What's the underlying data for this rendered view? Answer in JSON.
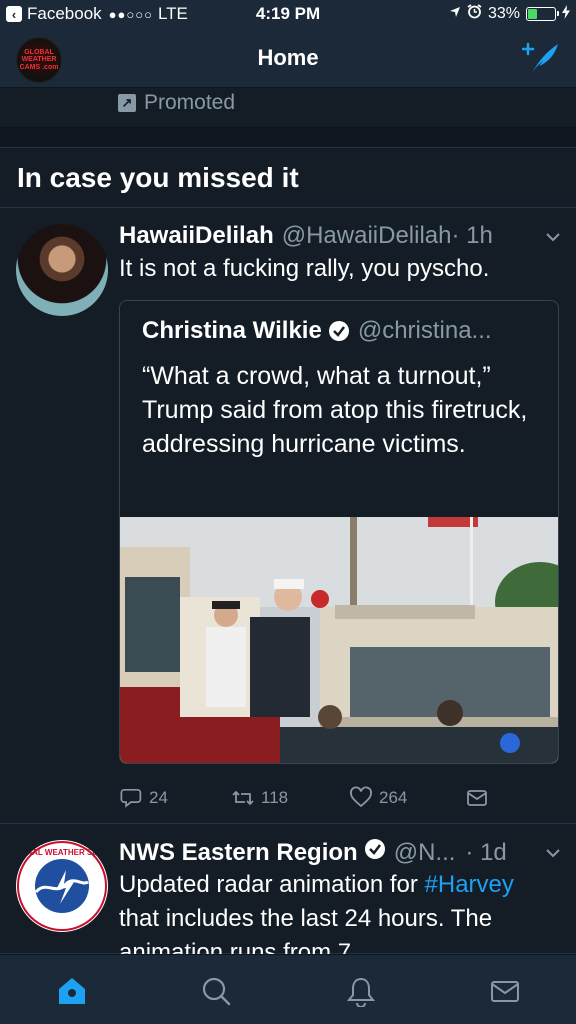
{
  "status_bar": {
    "back_app": "Facebook",
    "signal": "●●○○○",
    "network": "LTE",
    "time": "4:19 PM",
    "battery_percent": "33%",
    "battery_level": 0.33
  },
  "nav": {
    "title": "Home",
    "avatar_logo_text": "GLOBAL WEATHER CAMS .com"
  },
  "promoted": {
    "label": "Promoted"
  },
  "section": {
    "title": "In case you missed it"
  },
  "tweets": [
    {
      "name": "HawaiiDelilah",
      "handle": "@HawaiiDelilah",
      "time": "· 1h",
      "text": "It is not a fucking rally, you pyscho.",
      "quote": {
        "name": "Christina Wilkie",
        "handle": "@christina...",
        "text": "“What a crowd, what a turnout,” Trump said from atop this firetruck, addressing hurricane victims."
      },
      "actions": {
        "replies": "24",
        "retweets": "118",
        "likes": "264"
      }
    },
    {
      "name": "NWS Eastern Region",
      "handle": "@N...",
      "time": "· 1d",
      "text_before": "Updated radar animation for ",
      "hashtag": "#Harvey",
      "text_after": " that includes the last 24 hours. The animation runs from 7",
      "avatar_logo_text": "NATIONAL WEATHER SERVICE"
    }
  ],
  "icons": {
    "back": "chevron-left-icon",
    "compose": "compose-tweet-icon",
    "tab_home": "home-icon",
    "tab_search": "search-icon",
    "tab_notifications": "bell-icon",
    "tab_messages": "envelope-icon"
  },
  "colors": {
    "background": "#141d26",
    "bar": "#1c2938",
    "accent": "#1da1f2",
    "muted": "#8899a6",
    "battery": "#4cd964"
  }
}
